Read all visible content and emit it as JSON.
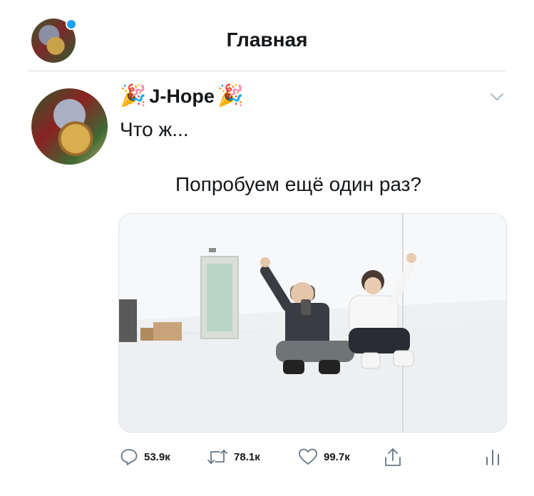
{
  "header": {
    "title": "Главная"
  },
  "tweet": {
    "emoji_left": "🎉",
    "display_name": "J-Hope",
    "emoji_right": "🎉",
    "handle_faded": "@...",
    "text_line1": "Что ж...",
    "text_line2": "Попробуем ещё один раз?"
  },
  "actions": {
    "reply_count": "53.9к",
    "retweet_count": "78.1к",
    "like_count": "99.7к"
  },
  "colors": {
    "accent": "#1da1f2",
    "icon_gray": "#657786"
  }
}
